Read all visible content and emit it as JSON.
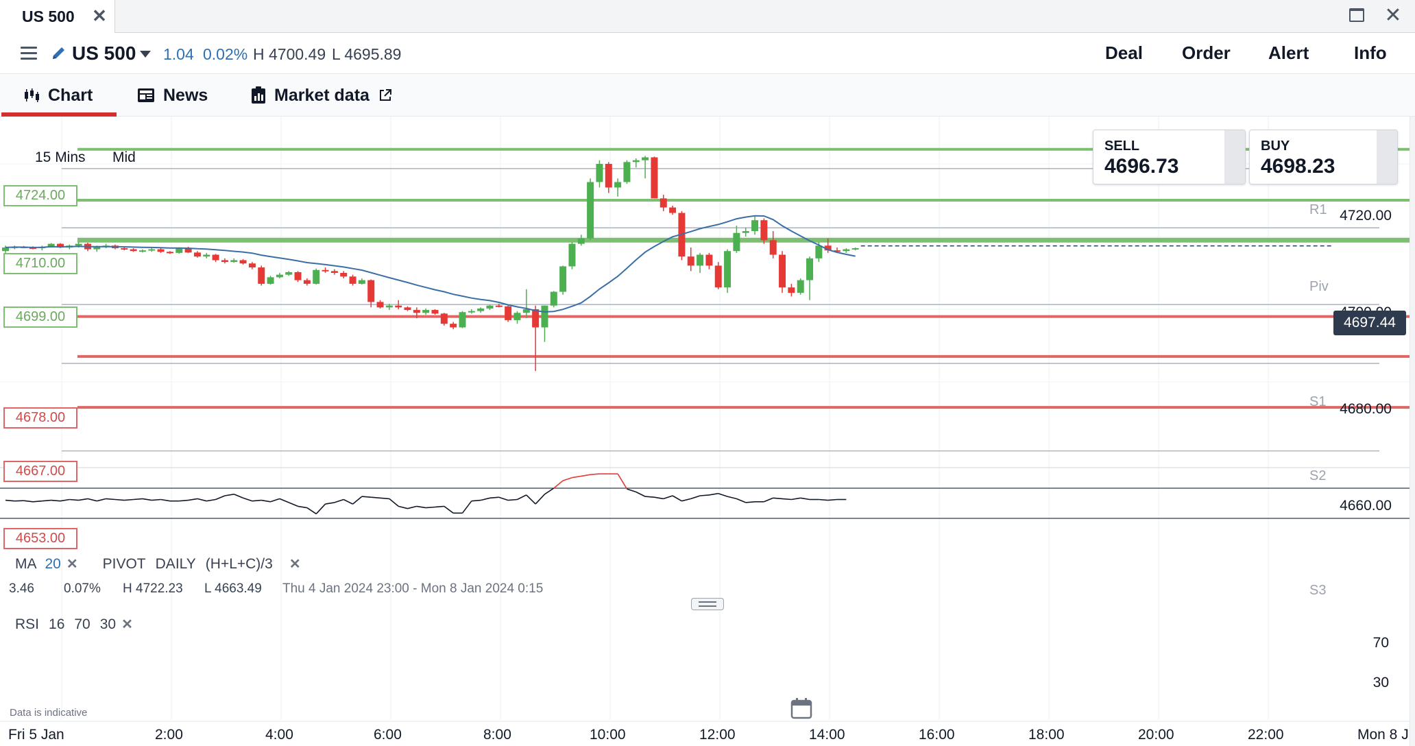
{
  "window": {
    "tab_title": "US 500",
    "close_glyph": "✕",
    "maximize_icon": "maximize-icon",
    "close_icon": "close-icon"
  },
  "header": {
    "instrument": "US 500",
    "change": "1.04",
    "change_pct": "0.02%",
    "high": "H 4700.49",
    "low": "L 4695.89",
    "actions": [
      "Deal",
      "Order",
      "Alert",
      "Info"
    ]
  },
  "subtabs": {
    "chart": "Chart",
    "news": "News",
    "market_data": "Market data"
  },
  "chart": {
    "timeframe": "15 Mins",
    "price_type": "Mid",
    "sell_label": "SELL",
    "sell_price": "4696.73",
    "buy_label": "BUY",
    "buy_price": "4698.23",
    "current_price": "4697.44",
    "level_tags": [
      {
        "label": "4724.00",
        "color": "green"
      },
      {
        "label": "4710.00",
        "color": "green"
      },
      {
        "label": "4699.00",
        "color": "green"
      },
      {
        "label": "4678.00",
        "color": "red"
      },
      {
        "label": "4667.00",
        "color": "red"
      },
      {
        "label": "4653.00",
        "color": "red"
      }
    ],
    "price_axis": [
      "4720.00",
      "4700.00",
      "4680.00",
      "4660.00"
    ],
    "pivot_labels": [
      "R1",
      "Piv",
      "S1",
      "S2",
      "S3"
    ],
    "time_axis": [
      "Fri 5 Jan",
      "2:00",
      "4:00",
      "6:00",
      "8:00",
      "10:00",
      "12:00",
      "14:00",
      "16:00",
      "18:00",
      "20:00",
      "22:00",
      "Mon 8 J"
    ],
    "colors": {
      "up": "#4caf50",
      "down": "#e53935",
      "ma": "#3a6ea5",
      "green_level": "#7cbf70",
      "red_level": "#e06666"
    }
  },
  "indicators": {
    "ma_label": "MA",
    "ma_period": "20",
    "pivot_label": "PIVOT",
    "pivot_period": "DAILY",
    "pivot_formula": "(H+L+C)/3",
    "remove_glyph": "✕",
    "rsi_label": "RSI",
    "rsi_period": "16",
    "rsi_upper": "70",
    "rsi_lower": "30",
    "rsi_axis": [
      "70",
      "30"
    ]
  },
  "stats": {
    "change": "3.46",
    "change_pct": "0.07%",
    "high": "H 4722.23",
    "low": "L 4663.49",
    "range": "Thu 4 Jan 2024 23:00 - Mon 8 Jan 2024 0:15"
  },
  "footer": {
    "disclaimer": "Data is indicative"
  },
  "chart_data": {
    "type": "candlestick",
    "time_range": [
      "Fri 5 Jan 00:00",
      "Fri 5 Jan 22:15"
    ],
    "interval_minutes": 15,
    "ylim": [
      4650,
      4728
    ],
    "ohlc": [
      [
        4696.0,
        4697.5,
        4695.5,
        4697.0
      ],
      [
        4697.0,
        4697.5,
        4696.5,
        4697.2
      ],
      [
        4697.2,
        4697.4,
        4696.8,
        4697.0
      ],
      [
        4697.0,
        4697.3,
        4696.5,
        4696.8
      ],
      [
        4696.8,
        4697.5,
        4696.2,
        4697.2
      ],
      [
        4697.2,
        4698.2,
        4697.0,
        4698.0
      ],
      [
        4698.0,
        4698.2,
        4696.8,
        4697.0
      ],
      [
        4697.0,
        4697.8,
        4696.5,
        4697.5
      ],
      [
        4697.5,
        4698.5,
        4697.0,
        4698.0
      ],
      [
        4698.0,
        4698.3,
        4696.0,
        4696.5
      ],
      [
        4696.5,
        4697.5,
        4695.8,
        4697.3
      ],
      [
        4697.3,
        4698.0,
        4696.8,
        4697.5
      ],
      [
        4697.5,
        4697.8,
        4696.5,
        4696.8
      ],
      [
        4696.8,
        4697.2,
        4696.2,
        4696.5
      ],
      [
        4696.5,
        4696.8,
        4695.8,
        4696.0
      ],
      [
        4696.0,
        4696.5,
        4695.6,
        4696.2
      ],
      [
        4696.2,
        4696.8,
        4695.8,
        4696.5
      ],
      [
        4696.5,
        4697.0,
        4695.5,
        4695.8
      ],
      [
        4695.8,
        4696.0,
        4695.2,
        4695.5
      ],
      [
        4695.5,
        4697.0,
        4695.3,
        4696.8
      ],
      [
        4696.8,
        4697.2,
        4695.5,
        4695.6
      ],
      [
        4695.6,
        4696.0,
        4694.2,
        4694.5
      ],
      [
        4694.5,
        4695.5,
        4694.0,
        4695.0
      ],
      [
        4695.0,
        4695.2,
        4693.0,
        4693.5
      ],
      [
        4693.5,
        4694.0,
        4692.6,
        4693.0
      ],
      [
        4693.0,
        4694.0,
        4692.8,
        4693.5
      ],
      [
        4693.5,
        4693.8,
        4692.3,
        4692.6
      ],
      [
        4692.6,
        4693.0,
        4691.0,
        4691.5
      ],
      [
        4691.5,
        4692.0,
        4686.5,
        4687.0
      ],
      [
        4687.0,
        4689.2,
        4686.8,
        4688.8
      ],
      [
        4688.8,
        4690.0,
        4688.5,
        4689.5
      ],
      [
        4689.5,
        4690.5,
        4689.2,
        4690.2
      ],
      [
        4690.2,
        4690.5,
        4687.5,
        4688.0
      ],
      [
        4688.0,
        4688.5,
        4686.5,
        4687.0
      ],
      [
        4687.0,
        4691.2,
        4686.8,
        4690.8
      ],
      [
        4690.8,
        4691.5,
        4690.0,
        4690.5
      ],
      [
        4690.5,
        4691.0,
        4689.5,
        4690.0
      ],
      [
        4690.0,
        4690.5,
        4688.5,
        4689.0
      ],
      [
        4689.0,
        4689.5,
        4686.5,
        4687.0
      ],
      [
        4687.0,
        4688.5,
        4686.8,
        4688.0
      ],
      [
        4688.0,
        4688.2,
        4680.5,
        4682.0
      ],
      [
        4682.0,
        4682.5,
        4680.2,
        4680.5
      ],
      [
        4680.5,
        4681.5,
        4679.8,
        4681.0
      ],
      [
        4681.0,
        4682.5,
        4680.0,
        4680.5
      ],
      [
        4680.5,
        4680.8,
        4679.5,
        4679.8
      ],
      [
        4679.8,
        4680.5,
        4677.5,
        4679.0
      ],
      [
        4679.0,
        4680.2,
        4678.5,
        4679.8
      ],
      [
        4679.8,
        4680.0,
        4678.5,
        4678.8
      ],
      [
        4678.8,
        4679.0,
        4675.5,
        4676.0
      ],
      [
        4676.0,
        4676.5,
        4674.5,
        4675.0
      ],
      [
        4675.0,
        4679.5,
        4674.8,
        4679.2
      ],
      [
        4679.2,
        4680.0,
        4678.8,
        4679.5
      ],
      [
        4679.5,
        4680.5,
        4679.0,
        4680.2
      ],
      [
        4680.2,
        4681.2,
        4679.8,
        4681.0
      ],
      [
        4681.0,
        4681.5,
        4680.5,
        4680.8
      ],
      [
        4680.8,
        4681.0,
        4676.5,
        4677.0
      ],
      [
        4677.0,
        4679.5,
        4676.0,
        4679.0
      ],
      [
        4679.0,
        4685.5,
        4677.5,
        4680.0
      ],
      [
        4680.0,
        4681.0,
        4663.0,
        4675.0
      ],
      [
        4675.0,
        4681.0,
        4671.0,
        4681.0
      ],
      [
        4681.0,
        4685.0,
        4680.5,
        4684.8
      ],
      [
        4684.8,
        4692.0,
        4684.0,
        4691.8
      ],
      [
        4691.8,
        4698.5,
        4691.0,
        4698.0
      ],
      [
        4698.0,
        4700.5,
        4697.5,
        4699.5
      ],
      [
        4699.5,
        4716.0,
        4699.0,
        4715.0
      ],
      [
        4715.0,
        4721.0,
        4713.5,
        4720.0
      ],
      [
        4720.0,
        4720.5,
        4712.0,
        4713.5
      ],
      [
        4713.5,
        4716.0,
        4711.0,
        4715.0
      ],
      [
        4715.0,
        4721.0,
        4714.5,
        4720.5
      ],
      [
        4720.5,
        4721.5,
        4719.0,
        4721.0
      ],
      [
        4721.0,
        4722.2,
        4716.0,
        4721.8
      ],
      [
        4721.8,
        4722.0,
        4716.5,
        4710.5
      ],
      [
        4710.5,
        4711.5,
        4707.0,
        4708.0
      ],
      [
        4708.0,
        4708.5,
        4706.0,
        4706.5
      ],
      [
        4706.5,
        4707.0,
        4693.5,
        4694.5
      ],
      [
        4694.5,
        4697.0,
        4690.5,
        4692.0
      ],
      [
        4692.0,
        4695.5,
        4690.0,
        4695.0
      ],
      [
        4695.0,
        4695.5,
        4691.0,
        4692.0
      ],
      [
        4692.0,
        4693.0,
        4685.5,
        4686.0
      ],
      [
        4686.0,
        4696.5,
        4684.5,
        4696.0
      ],
      [
        4696.0,
        4703.0,
        4695.5,
        4701.0
      ],
      [
        4701.0,
        4702.5,
        4700.0,
        4701.5
      ],
      [
        4701.5,
        4705.5,
        4700.5,
        4704.5
      ],
      [
        4704.5,
        4705.0,
        4698.0,
        4699.0
      ],
      [
        4699.0,
        4701.5,
        4694.0,
        4695.0
      ],
      [
        4695.0,
        4696.0,
        4684.5,
        4686.0
      ],
      [
        4686.0,
        4687.0,
        4683.5,
        4684.5
      ],
      [
        4684.5,
        4688.5,
        4684.0,
        4688.0
      ],
      [
        4688.0,
        4694.5,
        4682.5,
        4694.0
      ],
      [
        4694.0,
        4698.5,
        4693.0,
        4697.5
      ],
      [
        4697.5,
        4699.5,
        4695.5,
        4696.2
      ],
      [
        4696.2,
        4697.0,
        4695.5,
        4696.0
      ],
      [
        4696.0,
        4696.8,
        4695.5,
        4696.5
      ],
      [
        4696.5,
        4697.0,
        4696.2,
        4696.8
      ]
    ],
    "rsi": [
      54,
      53,
      53.5,
      52,
      53,
      54,
      53,
      55,
      54,
      56,
      53,
      56,
      55,
      54,
      55,
      56,
      54,
      55,
      53,
      53,
      54,
      56,
      53,
      55,
      60,
      62,
      57,
      53,
      54,
      52,
      56,
      51,
      46,
      44,
      36,
      49,
      51,
      55,
      49,
      59,
      58,
      57,
      56,
      46,
      43,
      46,
      44,
      45,
      46,
      37,
      37,
      53,
      54,
      57,
      58,
      54,
      55,
      61,
      49,
      62,
      70,
      80,
      84,
      86,
      88,
      89,
      89,
      89,
      69,
      65,
      59,
      58,
      56,
      60,
      53,
      56,
      60,
      61,
      63,
      59,
      56,
      51,
      52,
      52,
      57,
      56,
      55,
      57,
      55,
      55,
      54,
      55,
      55
    ]
  }
}
